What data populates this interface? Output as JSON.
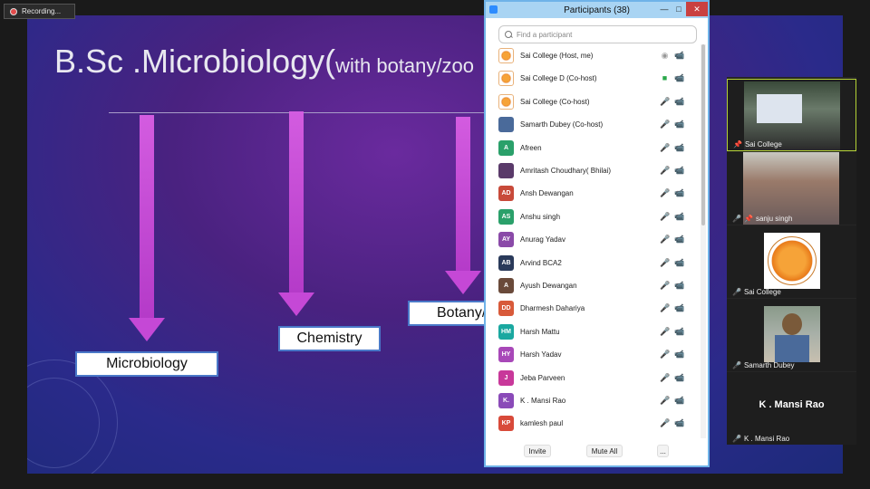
{
  "recording": {
    "label": "Recording..."
  },
  "slide": {
    "title_main": "B.Sc .Microbiology(",
    "title_sub": "with botany/zoo",
    "boxes": [
      "Microbiology",
      "Chemistry",
      "Botany/"
    ]
  },
  "participants_panel": {
    "title": "Participants (38)",
    "search_placeholder": "Find a participant",
    "people": [
      {
        "name": "Sai College (Host, me)",
        "initials": "",
        "color": ""
      },
      {
        "name": "Sai College D (Co-host)",
        "initials": "",
        "color": ""
      },
      {
        "name": "Sai College (Co-host)",
        "initials": "",
        "color": ""
      },
      {
        "name": "Samarth Dubey (Co-host)",
        "initials": "",
        "color": "#4a6a9a"
      },
      {
        "name": "Afreen",
        "initials": "A",
        "color": "#2aa06a"
      },
      {
        "name": "Amritash Choudhary( Bhilai)",
        "initials": "",
        "color": "#5a3a6a"
      },
      {
        "name": "Ansh Dewangan",
        "initials": "AD",
        "color": "#c84a3a"
      },
      {
        "name": "Anshu singh",
        "initials": "AS",
        "color": "#2aa06a"
      },
      {
        "name": "Anurag Yadav",
        "initials": "AY",
        "color": "#8a4aa8"
      },
      {
        "name": "Arvind BCA2",
        "initials": "AB",
        "color": "#2a3a5a"
      },
      {
        "name": "Ayush Dewangan",
        "initials": "A",
        "color": "#6a4a3a"
      },
      {
        "name": "Dharmesh Dahariya",
        "initials": "DD",
        "color": "#d85a3a"
      },
      {
        "name": "Harsh Mattu",
        "initials": "HM",
        "color": "#1aa8a0"
      },
      {
        "name": "Harsh Yadav",
        "initials": "HY",
        "color": "#a848b8"
      },
      {
        "name": "Jeba Parveen",
        "initials": "J",
        "color": "#c8389a"
      },
      {
        "name": "K . Mansi Rao",
        "initials": "K.",
        "color": "#8a4ab8"
      },
      {
        "name": "kamlesh paul",
        "initials": "KP",
        "color": "#d84a3a"
      }
    ],
    "footer": {
      "invite": "Invite",
      "mute_all": "Mute All",
      "more": "..."
    }
  },
  "video_strip": [
    {
      "label": "Sai College"
    },
    {
      "label": "sanju singh"
    },
    {
      "label": "Sai College"
    },
    {
      "label": "Samarth Dubey"
    },
    {
      "label": "K . Mansi Rao",
      "big_name": "K . Mansi Rao"
    }
  ],
  "colors": {
    "slide_bg": "#4a2280",
    "arrow": "#c548d6",
    "box_border": "#4a78c8",
    "panel_border": "#6fb3e8",
    "active_speaker": "#b4d236",
    "muted": "#d23a3a"
  },
  "icons": {
    "recording": "record-dot-icon",
    "search": "search-icon",
    "mic_off": "mic-off-icon",
    "cam_off": "video-off-icon"
  }
}
